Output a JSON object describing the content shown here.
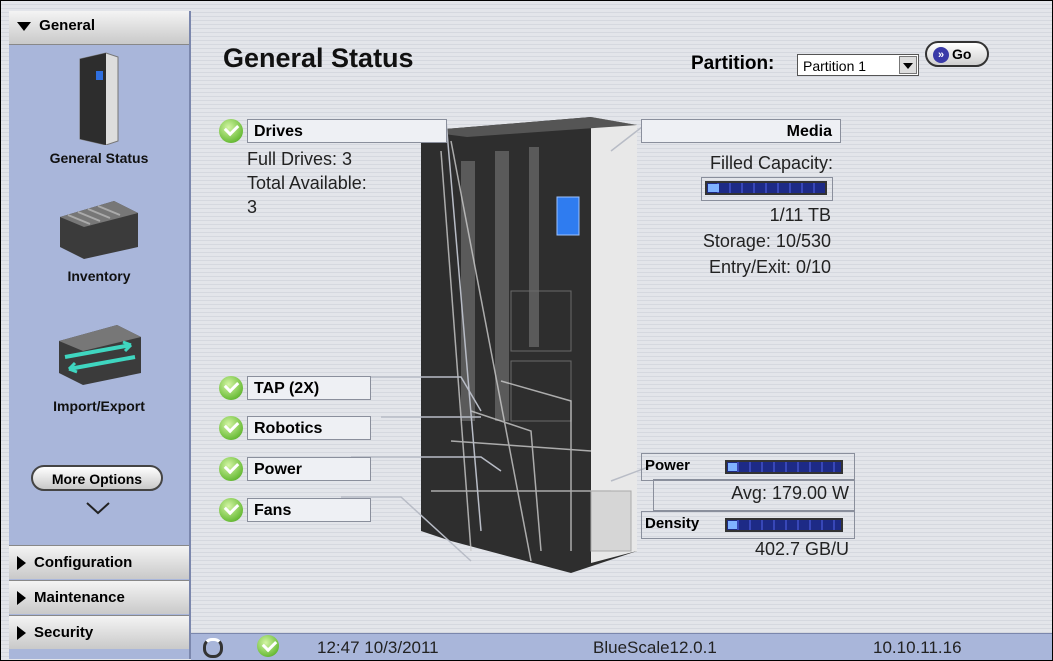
{
  "sidebar": {
    "header": "General",
    "items": [
      {
        "label": "General Status"
      },
      {
        "label": "Inventory"
      },
      {
        "label": "Import/Export"
      }
    ],
    "more_options": "More Options",
    "sections": [
      "Configuration",
      "Maintenance",
      "Security"
    ]
  },
  "main": {
    "title": "General Status",
    "partition_label": "Partition:",
    "partition_value": "Partition 1",
    "go_label": "Go",
    "drives": {
      "label": "Drives",
      "full": "Full Drives: 3",
      "total_label": "Total Available:",
      "total_value": "3"
    },
    "media": {
      "label": "Media",
      "filled_label": "Filled Capacity:",
      "filled_fraction": 0.09,
      "capacity": "1/11 TB",
      "storage": "Storage: 10/530",
      "entry_exit": "Entry/Exit: 0/10"
    },
    "status_items": [
      "TAP (2X)",
      "Robotics",
      "Power",
      "Fans"
    ],
    "power": {
      "label": "Power",
      "avg": "Avg: 179.00 W",
      "fraction": 0.08
    },
    "density": {
      "label": "Density",
      "value": "402.7 GB/U",
      "fraction": 0.08
    }
  },
  "statusbar": {
    "time": "12:47 10/3/2011",
    "version": "BlueScale12.0.1",
    "ip": "10.10.11.16"
  }
}
